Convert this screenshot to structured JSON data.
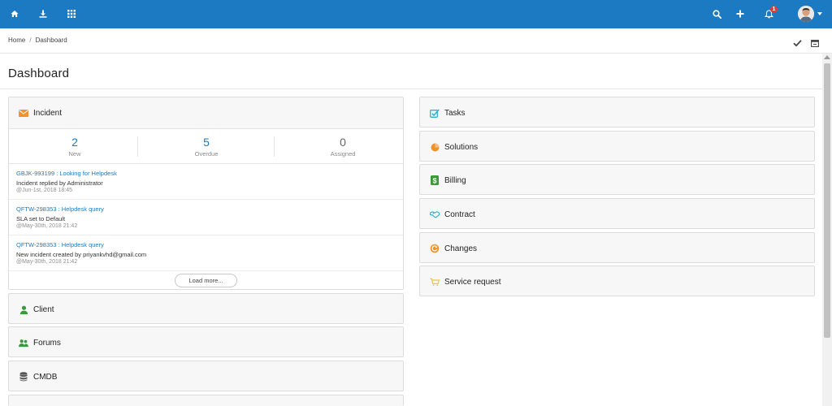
{
  "topbar": {
    "icons": [
      "home-icon",
      "download-icon",
      "apps-grid-icon",
      "search-icon",
      "plus-icon",
      "bell-icon"
    ],
    "notification_count": "1",
    "brand_color": "#1c7ac2"
  },
  "breadcrumb": {
    "home": "Home",
    "current": "Dashboard"
  },
  "page": {
    "title": "Dashboard"
  },
  "incident": {
    "title": "Incident",
    "stats": [
      {
        "value": "2",
        "label": "New"
      },
      {
        "value": "5",
        "label": "Overdue"
      },
      {
        "value": "0",
        "label": "Assigned"
      }
    ],
    "feed": [
      {
        "link": "GBJK-993199 : Looking for Helpdesk",
        "desc": "Incident replied by Administrator",
        "time": "@Jun-1st, 2018 18:45"
      },
      {
        "link": "QFTW-298353 : Helpdesk query",
        "desc": "SLA set to Default",
        "time": "@May-30th, 2018 21:42"
      },
      {
        "link": "QFTW-298353 : Helpdesk query",
        "desc": "New incident created by priyankvhd@gmail.com",
        "time": "@May-30th, 2018 21:42"
      }
    ],
    "load_more": "Load more..."
  },
  "left_panels": [
    {
      "title": "Client"
    },
    {
      "title": "Forums"
    },
    {
      "title": "CMDB"
    }
  ],
  "right_panels": [
    {
      "title": "Tasks"
    },
    {
      "title": "Solutions"
    },
    {
      "title": "Billing"
    },
    {
      "title": "Contract"
    },
    {
      "title": "Changes"
    },
    {
      "title": "Service request"
    }
  ]
}
